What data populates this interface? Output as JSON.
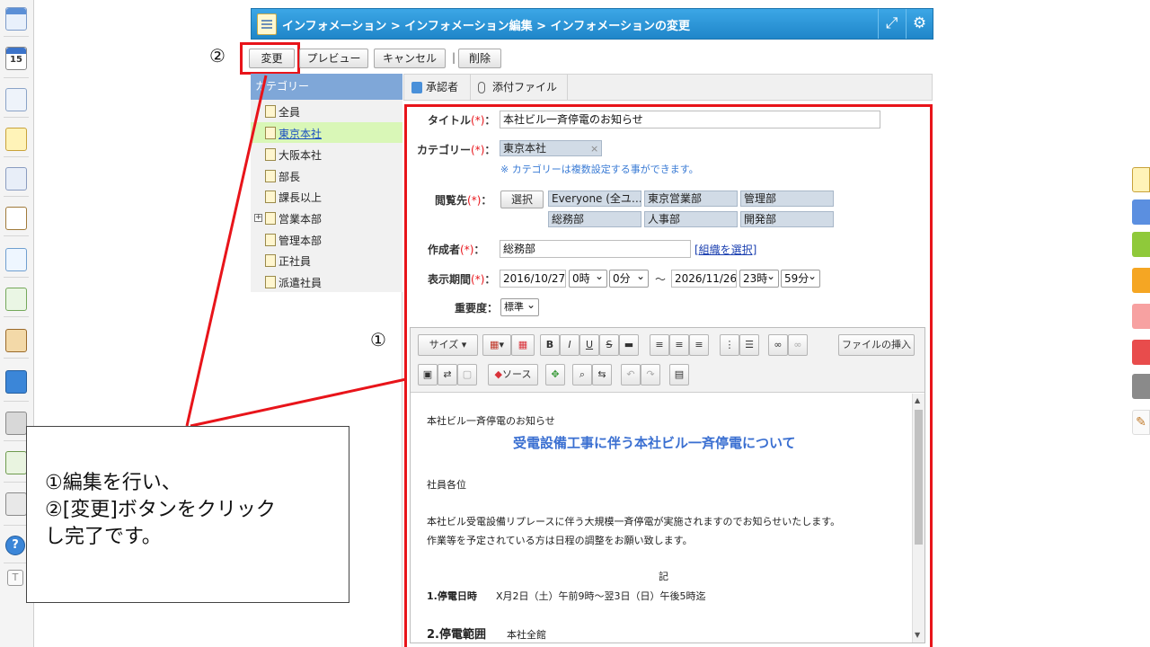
{
  "header": {
    "breadcrumb": "インフォメーション > インフォメーション編集 > インフォメーションの変更",
    "expand_icon": "expand-icon",
    "settings_icon": "gear-icon"
  },
  "toolbar": {
    "change_label": "変更",
    "preview_label": "プレビュー",
    "cancel_label": "キャンセル",
    "separator": "|",
    "delete_label": "削除"
  },
  "annotations": {
    "marker_1": "①",
    "marker_2": "②",
    "callout_line1": "①編集を行い、",
    "callout_line2": "②[変更]ボタンをクリック",
    "callout_line3": "し完了です。",
    "highlight_color": "#e8141a"
  },
  "categories": {
    "header": "カテゴリー",
    "items": [
      {
        "label": "全員"
      },
      {
        "label": "東京本社"
      },
      {
        "label": "大阪本社"
      },
      {
        "label": "部長"
      },
      {
        "label": "課長以上"
      },
      {
        "label": "営業本部"
      },
      {
        "label": "管理本部"
      },
      {
        "label": "正社員"
      },
      {
        "label": "派遣社員"
      }
    ],
    "selected_index": 1,
    "expander": "+"
  },
  "tabs": [
    {
      "label": "承認者"
    },
    {
      "label": "添付ファイル"
    }
  ],
  "form": {
    "title_label": "タイトル",
    "title_value": "本社ビル一斉停電のお知らせ",
    "required_mark": "(*)",
    "colon": "：",
    "category_label": "カテゴリー",
    "category_value": "東京本社",
    "category_remove": "×",
    "category_note": "※ カテゴリーは複数設定する事ができます。",
    "viewer_label": "閲覧先",
    "select_button": "選択",
    "viewers": [
      "Everyone (全ユ…",
      "東京営業部",
      "管理部",
      "総務部",
      "人事部",
      "開発部"
    ],
    "author_label": "作成者",
    "author_value": "総務部",
    "org_select_link": "[組織を選択]",
    "period_label": "表示期間",
    "start_date": "2016/10/27",
    "start_hour": "0時",
    "start_min": "0分",
    "tilde": "～",
    "end_date": "2026/11/26",
    "end_hour": "23時",
    "end_min": "59分",
    "priority_label": "重要度",
    "priority_value": "標準"
  },
  "editor": {
    "size_label": "サイズ",
    "insert_file_label": "ファイルの挿入",
    "source_label": "ソース",
    "bold": "B",
    "italic": "I",
    "underline": "U",
    "strike": "S",
    "content": {
      "line_subject": "本社ビル一斉停電のお知らせ",
      "heading": "受電設備工事に伴う本社ビル一斉停電について",
      "greeting": "社員各位",
      "body1": "本社ビル受電設備リプレースに伴う大規模一斉停電が実施されますのでお知らせいたします。",
      "body2": "作業等を予定されている方は日程の調整をお願い致します。",
      "ki": "記",
      "item1_label": "1.停電日時",
      "item1_value": "X月2日（土）午前9時～翌3日（日）午後5時迄",
      "item2_label": "2.停電範囲",
      "item2_value": "本社全館"
    },
    "heading_color": "#3a6fd1"
  },
  "leftbar": {
    "calendar_day": "15",
    "help_glyph": "?",
    "text_glyph": "T"
  }
}
